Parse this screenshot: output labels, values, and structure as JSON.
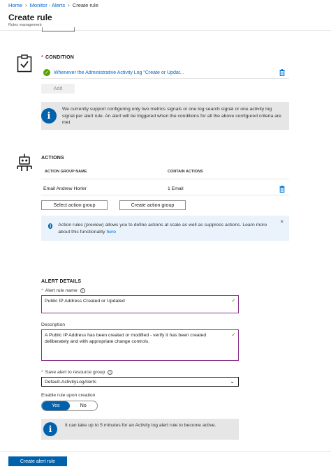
{
  "breadcrumb": {
    "home": "Home",
    "monitor": "Monitor - Alerts",
    "current": "Create rule",
    "sep": "›"
  },
  "header": {
    "title": "Create rule",
    "subtitle": "Rules management"
  },
  "condition": {
    "title": "CONDITION",
    "required_mark": "*",
    "item": "Whenever the Administrative Activity Log \"Create or Updat...",
    "add_label": "Add",
    "info_text": "We currently support configuring only two metrics signals or one log search signal or one activity log signal per alert rule. An alert will be triggered when the conditions for all the above configured criteria are met"
  },
  "actions": {
    "title": "ACTIONS",
    "columns": [
      "ACTION GROUP NAME",
      "CONTAIN ACTIONS"
    ],
    "rows": [
      {
        "name": "Email Andrew Horler",
        "actions": "1 Email"
      }
    ],
    "select_label": "Select action group",
    "create_label": "Create action group",
    "info_text": "Action rules (preview) allows you to define actions at scale as well as suppress actions. Learn more about this functionality",
    "info_link": "here",
    "close": "×"
  },
  "alert_details": {
    "title": "ALERT DETAILS",
    "name_label": "Alert rule name",
    "name_value": "Public IP Address Created or Updated",
    "desc_label": "Description",
    "desc_value": "A Public IP Address has been created or modified - verify it has been created deliberately and with appropriate change controls.",
    "rg_label": "Save alert to resource group",
    "rg_value": "Default-ActivityLogAlerts",
    "enable_label": "Enable rule upon creation",
    "toggle_yes": "Yes",
    "toggle_no": "No",
    "info_text": "It can take up to 5 minutes for an Activity log alert rule to become active.",
    "required_mark": "*",
    "tip": "i",
    "check": "✓"
  },
  "footer": {
    "create_label": "Create alert rule"
  },
  "colors": {
    "primary": "#0062ad",
    "link": "#0066cc",
    "success": "#57a300",
    "required": "#d13438",
    "focus_border": "#8b2f8b"
  }
}
